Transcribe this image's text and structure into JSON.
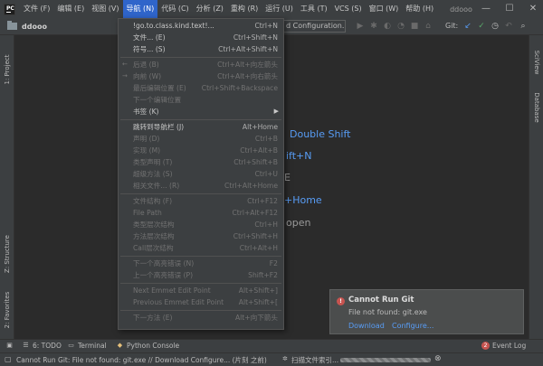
{
  "menubar": {
    "items": [
      "文件 (F)",
      "编辑 (E)",
      "视图 (V)",
      "导航 (N)",
      "代码 (C)",
      "分析 (Z)",
      "重构 (R)",
      "运行 (U)",
      "工具 (T)",
      "VCS (S)",
      "窗口 (W)",
      "帮助 (H)"
    ],
    "window_title": "ddooo"
  },
  "navbar": {
    "project": "ddooo",
    "run_config": "d Configuration...",
    "git_label": "Git:"
  },
  "nav_menu": {
    "items": [
      {
        "label": "!go.to.class.kind.text!...",
        "shortcut": "Ctrl+N"
      },
      {
        "label": "文件... (E)",
        "shortcut": "Ctrl+Shift+N"
      },
      {
        "label": "符号... (S)",
        "shortcut": "Ctrl+Alt+Shift+N"
      },
      {
        "label": "后退 (B)",
        "shortcut": "Ctrl+Alt+向左箭头"
      },
      {
        "label": "向前 (W)",
        "shortcut": "Ctrl+Alt+向右箭头"
      },
      {
        "label": "最后编辑位置 (E)",
        "shortcut": "Ctrl+Shift+Backspace"
      },
      {
        "label": "下一个编辑位置",
        "shortcut": ""
      },
      {
        "label": "书签 (K)",
        "shortcut": ""
      },
      {
        "label": "跳转到导航栏 (J)",
        "shortcut": "Alt+Home"
      },
      {
        "label": "声明 (D)",
        "shortcut": "Ctrl+B"
      },
      {
        "label": "实现 (M)",
        "shortcut": "Ctrl+Alt+B"
      },
      {
        "label": "类型声明 (T)",
        "shortcut": "Ctrl+Shift+B"
      },
      {
        "label": "超级方法 (S)",
        "shortcut": "Ctrl+U"
      },
      {
        "label": "相关文件... (R)",
        "shortcut": "Ctrl+Alt+Home"
      },
      {
        "label": "文件结构 (F)",
        "shortcut": "Ctrl+F12"
      },
      {
        "label": "File Path",
        "shortcut": "Ctrl+Alt+F12"
      },
      {
        "label": "类型层次结构",
        "shortcut": "Ctrl+H"
      },
      {
        "label": "方法层次结构",
        "shortcut": "Ctrl+Shift+H"
      },
      {
        "label": "Call层次结构",
        "shortcut": "Ctrl+Alt+H"
      },
      {
        "label": "下一个高亮错误 (N)",
        "shortcut": "F2"
      },
      {
        "label": "上一个高亮错误 (P)",
        "shortcut": "Shift+F2"
      },
      {
        "label": "Next Emmet Edit Point",
        "shortcut": "Alt+Shift+]"
      },
      {
        "label": "Previous Emmet Edit Point",
        "shortcut": "Alt+Shift+["
      },
      {
        "label": "下一方法 (E)",
        "shortcut": "Alt+向下箭头"
      },
      {
        "label": "上一方法 (I)",
        "shortcut": "Alt+向上箭头"
      }
    ]
  },
  "editor": {
    "hint_double_shift": "Double Shift",
    "hint_shift_n": "ift+N",
    "hint_e": "E",
    "hint_home": "+Home",
    "hint_open": "open"
  },
  "side_tabs": {
    "project": "1: Project",
    "structure": "Z: Structure",
    "favorites": "2: Favorites",
    "sciview": "SciView",
    "database": "Database"
  },
  "notification": {
    "title": "Cannot Run Git",
    "message": "File not found: git.exe",
    "link_download": "Download",
    "link_configure": "Configure..."
  },
  "tool_windows": {
    "todo": "6: TODO",
    "terminal": "Terminal",
    "python_console": "Python Console",
    "event_log": "Event Log",
    "event_count": "2"
  },
  "statusbar": {
    "message": "Cannot Run Git: File not found: git.exe // Download  Configure... (片刻 之前)",
    "indexing": "扫描文件索引..."
  }
}
